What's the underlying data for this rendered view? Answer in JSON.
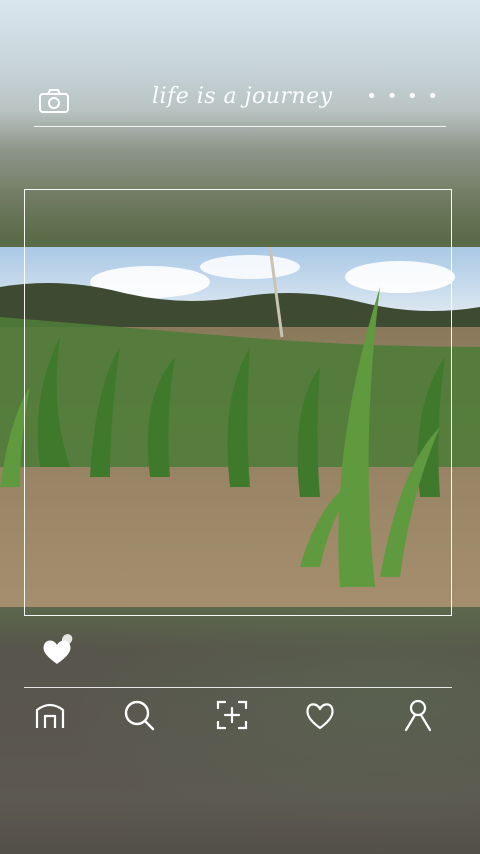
{
  "header": {
    "caption": "life is a journey",
    "more": "• • • •"
  },
  "nav": {
    "items": [
      "home",
      "search",
      "add",
      "favorites",
      "profile"
    ]
  },
  "icons": {
    "camera": "camera-icon",
    "like": "double-heart-icon",
    "home": "home-icon",
    "search": "search-icon",
    "add": "add-post-icon",
    "favorites": "heart-outline-icon",
    "profile": "profile-icon"
  },
  "colors": {
    "line": "#ffffff"
  }
}
